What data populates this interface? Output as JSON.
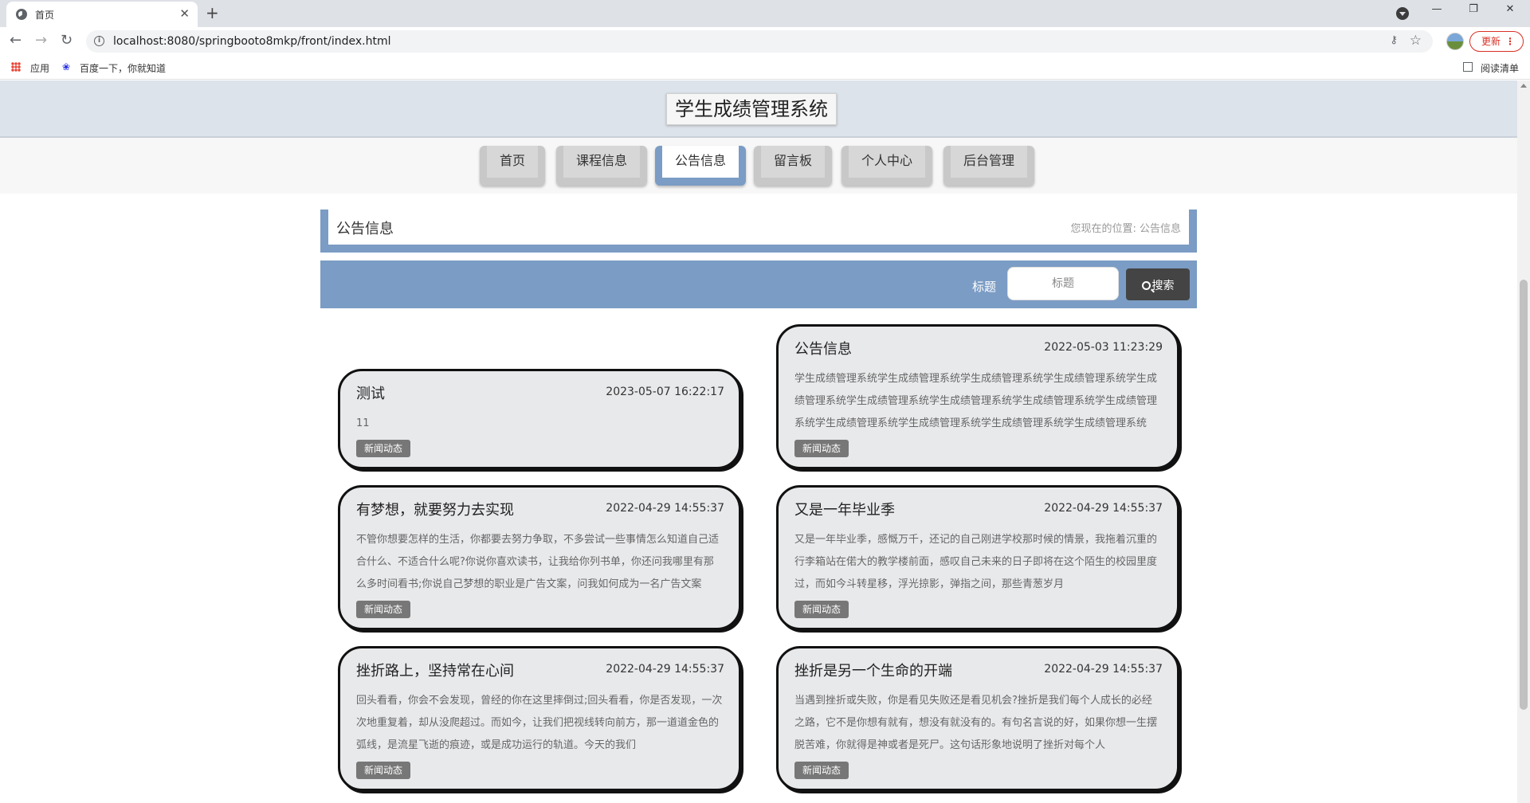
{
  "browser": {
    "tab_title": "首页",
    "tab_close": "✕",
    "new_tab": "+",
    "url": "localhost:8080/springbooto8mkp/front/index.html",
    "update_label": "更新",
    "bookmarks": [
      "应用",
      "百度一下，你就知道"
    ],
    "reading_list": "阅读清单",
    "icons": [
      "back-arrow-icon",
      "forward-arrow-icon",
      "reload-icon",
      "info-icon",
      "key-icon",
      "star-icon",
      "avatar-icon"
    ]
  },
  "site": {
    "title": "学生成绩管理系统",
    "nav": [
      {
        "label": "首页",
        "active": false
      },
      {
        "label": "课程信息",
        "active": false
      },
      {
        "label": "公告信息",
        "active": true
      },
      {
        "label": "留言板",
        "active": false
      },
      {
        "label": "个人中心",
        "active": false
      },
      {
        "label": "后台管理",
        "active": false
      }
    ],
    "accent_color": "#7b9cc4"
  },
  "breadcrumb": {
    "title": "公告信息",
    "location_prefix": "您现在的位置:",
    "location": "公告信息"
  },
  "search": {
    "label": "标题",
    "placeholder": "标题",
    "button_label": "搜索"
  },
  "cards": [
    {
      "title": "测试",
      "date": "2023-05-07 16:22:17",
      "body": "11",
      "tag": "新闻动态"
    },
    {
      "title": "公告信息",
      "date": "2022-05-03 11:23:29",
      "body": "学生成绩管理系统学生成绩管理系统学生成绩管理系统学生成绩管理系统学生成绩管理系统学生成绩管理系统学生成绩管理系统学生成绩管理系统学生成绩管理系统学生成绩管理系统学生成绩管理系统学生成绩管理系统学生成绩管理系统",
      "tag": "新闻动态"
    },
    {
      "title": "有梦想，就要努力去实现",
      "date": "2022-04-29 14:55:37",
      "body": "不管你想要怎样的生活，你都要去努力争取，不多尝试一些事情怎么知道自己适合什么、不适合什么呢?你说你喜欢读书，让我给你列书单，你还问我哪里有那么多时间看书;你说自己梦想的职业是广告文案，问我如何成为一名广告文案",
      "tag": "新闻动态"
    },
    {
      "title": "又是一年毕业季",
      "date": "2022-04-29 14:55:37",
      "body": "又是一年毕业季，感慨万千，还记的自己刚进学校那时候的情景，我拖着沉重的行李箱站在偌大的教学楼前面，感叹自己未来的日子即将在这个陌生的校园里度过，而如今斗转星移，浮光掠影，弹指之间，那些青葱岁月",
      "tag": "新闻动态"
    },
    {
      "title": "挫折路上，坚持常在心间",
      "date": "2022-04-29 14:55:37",
      "body": "回头看看，你会不会发现，曾经的你在这里摔倒过;回头看看，你是否发现，一次次地重复着，却从没爬超过。而如今，让我们把视线转向前方，那一道道金色的弧线，是流星飞逝的痕迹，或是成功运行的轨道。今天的我们",
      "tag": "新闻动态"
    },
    {
      "title": "挫折是另一个生命的开端",
      "date": "2022-04-29 14:55:37",
      "body": "当遇到挫折或失败，你是看见失败还是看见机会?挫折是我们每个人成长的必经之路，它不是你想有就有，想没有就没有的。有句名言说的好，如果你想一生摆脱苦难，你就得是神或者是死尸。这句话形象地说明了挫折对每个人",
      "tag": "新闻动态"
    }
  ]
}
